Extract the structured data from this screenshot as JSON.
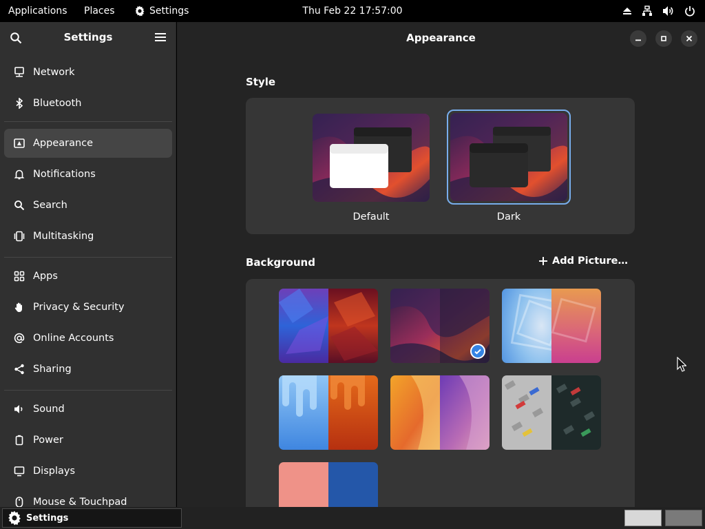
{
  "topbar": {
    "applications": "Applications",
    "places": "Places",
    "settings": "Settings",
    "clock": "Thu Feb 22  17:57:00",
    "icons": [
      "eject-icon",
      "network-wired-icon",
      "volume-icon",
      "power-icon"
    ]
  },
  "sidebar": {
    "title": "Settings",
    "items": [
      {
        "label": "Network",
        "icon": "network-icon"
      },
      {
        "label": "Bluetooth",
        "icon": "bluetooth-icon"
      },
      {
        "label": "Appearance",
        "icon": "appearance-icon",
        "active": true
      },
      {
        "label": "Notifications",
        "icon": "bell-icon"
      },
      {
        "label": "Search",
        "icon": "search-icon"
      },
      {
        "label": "Multitasking",
        "icon": "multitasking-icon"
      },
      {
        "label": "Apps",
        "icon": "apps-icon"
      },
      {
        "label": "Privacy & Security",
        "icon": "hand-icon"
      },
      {
        "label": "Online Accounts",
        "icon": "at-icon"
      },
      {
        "label": "Sharing",
        "icon": "share-icon"
      },
      {
        "label": "Sound",
        "icon": "speaker-icon"
      },
      {
        "label": "Power",
        "icon": "battery-icon"
      },
      {
        "label": "Displays",
        "icon": "display-icon"
      },
      {
        "label": "Mouse & Touchpad",
        "icon": "mouse-icon"
      }
    ]
  },
  "main": {
    "title": "Appearance",
    "style_section": "Style",
    "style_options": [
      {
        "label": "Default",
        "selected": false
      },
      {
        "label": "Dark",
        "selected": true
      }
    ],
    "background_section": "Background",
    "add_picture": "Add Picture…",
    "selected_background": 2
  },
  "taskbar": {
    "window_label": "Settings"
  },
  "colors": {
    "accent": "#78aeed",
    "check": "#3584e4",
    "sidebar_bg": "#303030",
    "main_bg": "#242424",
    "card_bg": "#363636"
  }
}
